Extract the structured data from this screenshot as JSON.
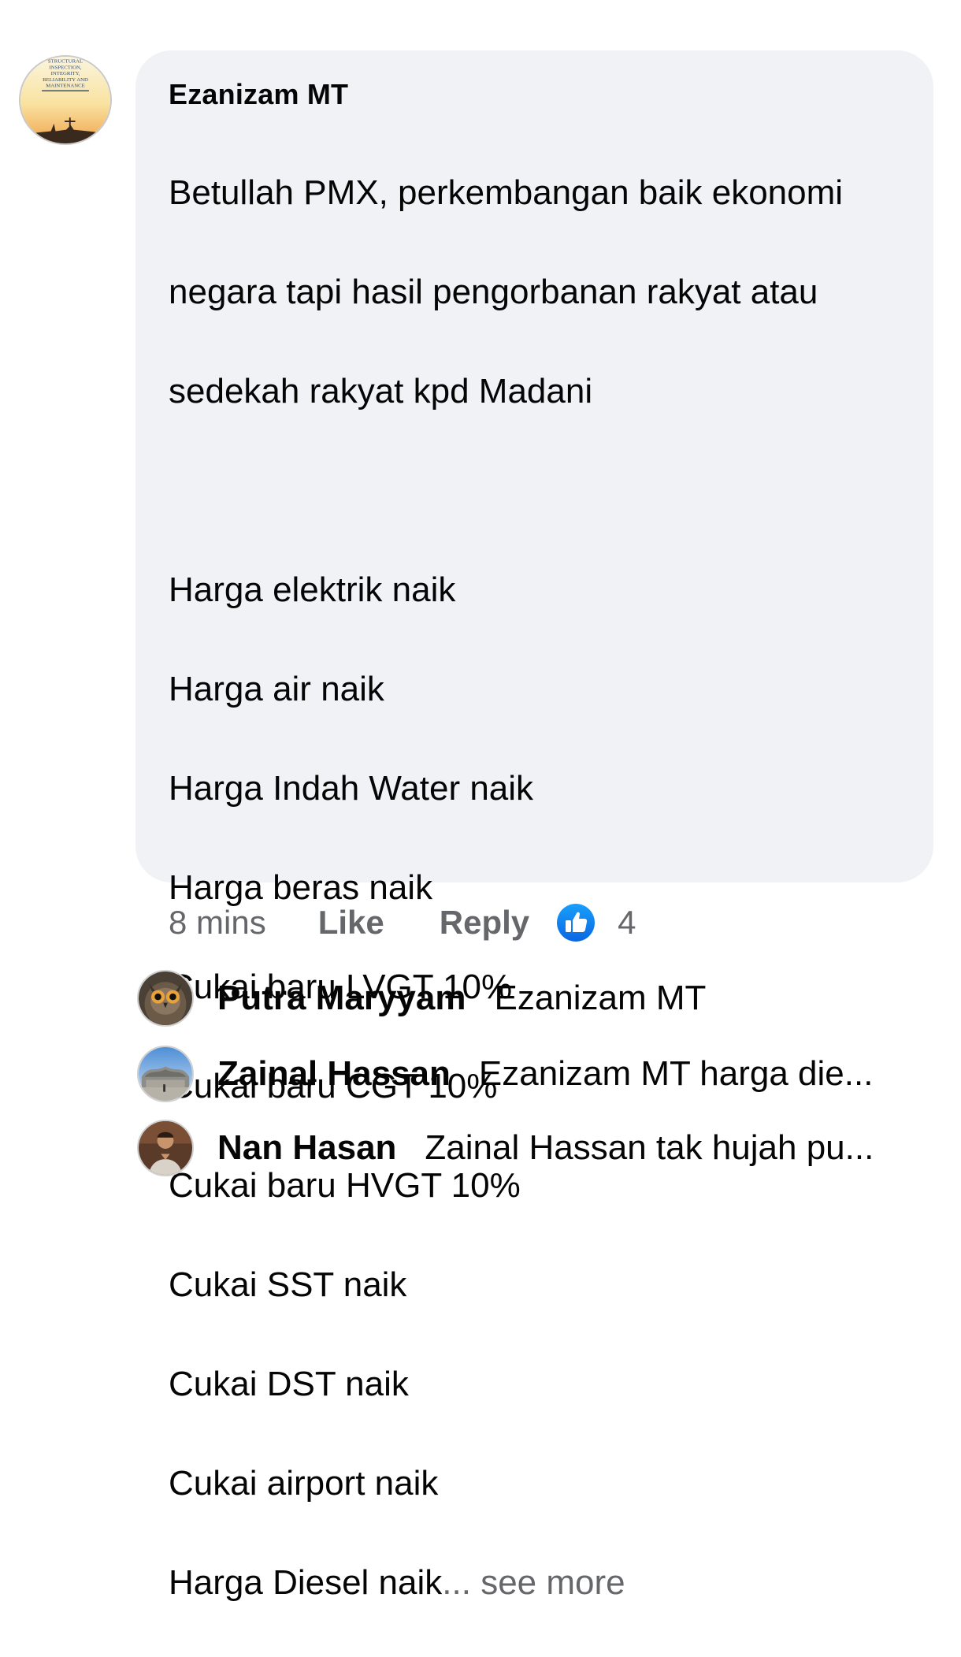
{
  "comment": {
    "author": "Ezanizam MT",
    "avatar_text": [
      "STRUCTURAL",
      "INSPECTION,",
      "INTEGRITY,",
      "RELIABILITY AND",
      "MAINTENANCE"
    ],
    "lines": [
      "Betullah PMX, perkembangan baik ekonomi",
      "negara tapi hasil pengorbanan rakyat atau",
      "sedekah rakyat kpd Madani",
      "",
      "Harga elektrik naik",
      "Harga air naik",
      "Harga Indah Water naik",
      "Harga beras naik",
      "Cukai baru LVGT 10%",
      "Cukai baru CGT 10%",
      "Cukai baru HVGT 10%",
      "Cukai SST naik",
      "Cukai DST naik",
      "Cukai airport naik"
    ],
    "last_line": "Harga Diesel naik",
    "ellipsis": "...",
    "see_more": " see more"
  },
  "actions": {
    "time": "8 mins",
    "like": "Like",
    "reply": "Reply",
    "reaction_icon": "like-thumb-icon",
    "reaction_count": "4",
    "accent_color": "#1877f2"
  },
  "replies": [
    {
      "author": "Putra Maryyam",
      "text": "Ezanizam MT",
      "avatar": "owl-avatar"
    },
    {
      "author": "Zainal Hassan",
      "text": "Ezanizam MT harga die...",
      "avatar": "building-avatar"
    },
    {
      "author": "Nan Hasan",
      "text": "Zainal Hassan tak hujah pu...",
      "avatar": "person-avatar"
    }
  ]
}
